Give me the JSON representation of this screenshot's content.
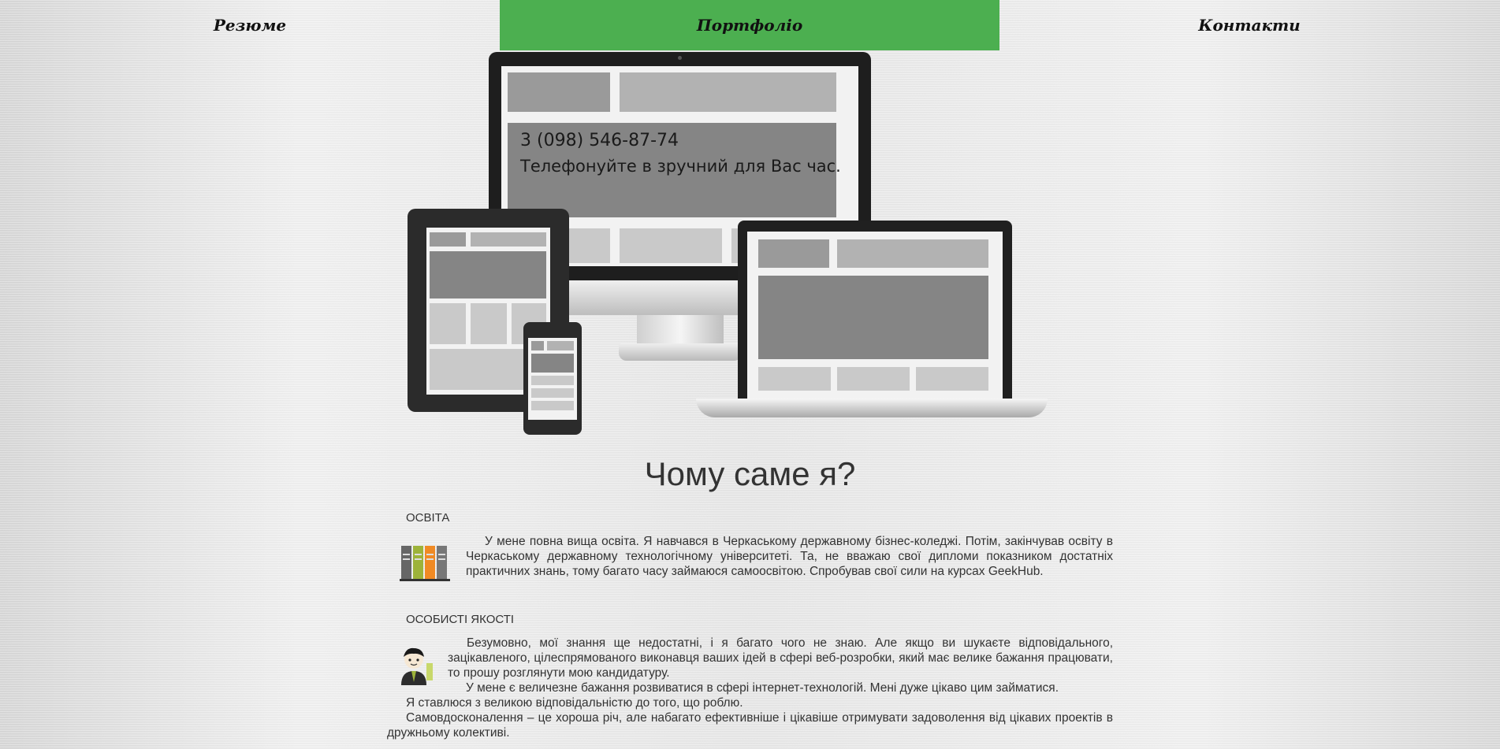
{
  "nav": {
    "resume": "Резюме",
    "portfolio": "Портфоліо",
    "contacts": "Контакти",
    "active_color": "#4caf50"
  },
  "hero": {
    "phone_line": "3 (098) 546-87-74",
    "call_text": "Телефонуйте в зручний для Вас час."
  },
  "main": {
    "heading": "Чому саме я?",
    "education": {
      "title": "ОСВІТА",
      "icon": "books-icon",
      "text": "У мене повна вища освіта. Я навчався в Черкаському державному бізнес-коледжі. Потім, закінчував освіту в Черкаському державному технологічному університеті. Та, не вважаю свої дипломи показником достатніх практичних знань, тому багато часу займаюся самоосвітою. Спробував свої сили на курсах GeekHub."
    },
    "qualities": {
      "title": "ОСОБИСТІ ЯКОСТІ",
      "icon": "person-icon",
      "p1": "Безумовно, мої знання ще недостатні, і я багато чого не знаю. Але якщо ви шукаєте відповідального, зацікавленого, цілеспрямованого виконавця ваших ідей в сфері веб-розробки, який має велике бажання працювати, то прошу розглянути мою кандидатуру.",
      "p2": "У мене є величезне бажання розвиватися в сфері інтернет-технологій. Мені дуже цікаво цим займатися.",
      "p3": "Я ставлюся з великою відповідальністю до того, що роблю.",
      "p4": "Самовдосконалення – це хороша річ, але набагато ефективніше і цікавіше отримувати задоволення від цікавих проектів в дружньому колективі."
    }
  }
}
